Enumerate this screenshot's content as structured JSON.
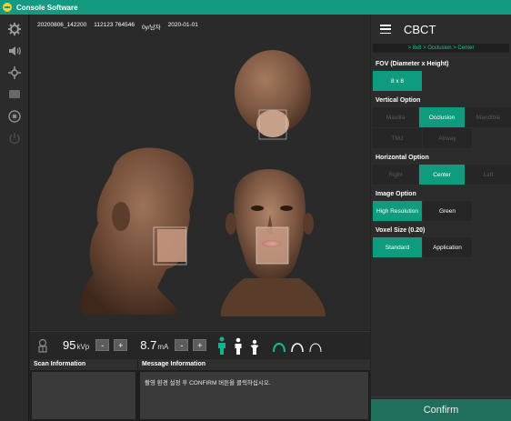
{
  "window": {
    "title": "Console Software"
  },
  "toolbar": {
    "icons": [
      "gear-icon",
      "speaker-icon",
      "network-icon",
      "monitor-icon",
      "settings-circle-icon",
      "power-icon"
    ]
  },
  "viewer": {
    "info": {
      "exam_id": "20200806_142200",
      "patient_id": "112123 764546",
      "age_sex": "0y/남자",
      "date": "2020-01-01"
    }
  },
  "controls": {
    "kvp_value": "95",
    "kvp_unit": "kVp",
    "ma_value": "8.7",
    "ma_unit": "mA",
    "minus": "-",
    "plus": "+"
  },
  "scan_panel": {
    "title": "Scan Information",
    "body": ""
  },
  "message_panel": {
    "title": "Message Information",
    "body": "촬영 환경 설정 후 CONFIRM 버튼을 클릭하십시오."
  },
  "side": {
    "title": "CBCT",
    "breadcrumb": "> 8x8 > Occlusion > Center",
    "fov": {
      "label": "FOV (Diameter x Height)",
      "options": [
        "8 x 8"
      ]
    },
    "vertical": {
      "label": "Vertical Option",
      "options": [
        "Maxilla",
        "Occlusion",
        "Mandible",
        "TMJ",
        "Airway"
      ]
    },
    "horizontal": {
      "label": "Horizontal Option",
      "options": [
        "Right",
        "Center",
        "Left"
      ]
    },
    "image": {
      "label": "Image Option",
      "options": [
        "High Resolution",
        "Green"
      ]
    },
    "voxel": {
      "label": "Voxel Size (0.20)",
      "options": [
        "Standard",
        "Application"
      ]
    },
    "confirm_label": "Confirm"
  },
  "colors": {
    "accent": "#0f9c7e",
    "title_bar": "#139a80",
    "breadcrumb": "#1cc4a0"
  }
}
